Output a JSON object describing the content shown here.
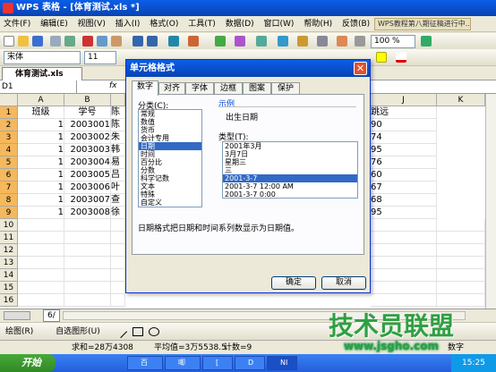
{
  "window": {
    "title": "WPS 表格 - [体育测试.xls *]"
  },
  "menu": [
    "文件(F)",
    "编辑(E)",
    "视图(V)",
    "插入(I)",
    "格式(O)",
    "工具(T)",
    "数据(D)",
    "窗口(W)",
    "帮助(H)",
    "反馈(B)"
  ],
  "banner": "WPS教程第八期征稿进行中...",
  "toolbar": {
    "zoom": "100 %"
  },
  "formatbar": {
    "font": "宋体",
    "size": "11"
  },
  "filetab": {
    "name": "体育测试.xls"
  },
  "formula": {
    "namebox": "D1",
    "fx": "fx"
  },
  "grid": {
    "columns": [
      "A",
      "B",
      "J",
      "K"
    ],
    "rows": [
      "1",
      "2",
      "3",
      "4",
      "5",
      "6",
      "7",
      "8",
      "9",
      "10",
      "11",
      "12",
      "13",
      "14",
      "15",
      "16"
    ],
    "headerA": "班级",
    "headerB": "学号",
    "headerC": "陈",
    "headerI": "跳远",
    "data": [
      {
        "a": "1",
        "b": "2003001",
        "c": "陈",
        "i": "90"
      },
      {
        "a": "1",
        "b": "2003002",
        "c": "朱",
        "i": "74"
      },
      {
        "a": "1",
        "b": "2003003",
        "c": "韩",
        "i": "95"
      },
      {
        "a": "1",
        "b": "2003004",
        "c": "易",
        "i": "76"
      },
      {
        "a": "1",
        "b": "2003005",
        "c": "吕",
        "i": "60"
      },
      {
        "a": "1",
        "b": "2003006",
        "c": "叶",
        "i": "67"
      },
      {
        "a": "1",
        "b": "2003007",
        "c": "查",
        "i": "68"
      },
      {
        "a": "1",
        "b": "2003008",
        "c": "徐",
        "i": "95"
      }
    ]
  },
  "sheetbar": {
    "tab": "6/"
  },
  "drawbar": {
    "label": "绘图(R)",
    "autoshape": "自选图形(U)"
  },
  "status": {
    "sum": "求和=28万4308",
    "avg": "平均值=3万5538.5",
    "count": "计数=9",
    "mode": "数字"
  },
  "taskbar": {
    "start": "开始",
    "items": [
      "百",
      "唧",
      "[",
      "D",
      "NI"
    ],
    "clock": "15:25"
  },
  "dialog": {
    "title": "单元格格式",
    "tabs": [
      "数字",
      "对齐",
      "字体",
      "边框",
      "图案",
      "保护"
    ],
    "category_label": "分类(C):",
    "categories": [
      "常规",
      "数值",
      "货币",
      "会计专用",
      "日期",
      "时间",
      "百分比",
      "分数",
      "科学记数",
      "文本",
      "特殊",
      "自定义"
    ],
    "selected_category": 4,
    "sample_label": "示例",
    "sample_value": "出生日期",
    "type_label": "类型(T):",
    "types": [
      "2001年3月",
      "3月7日",
      "星期三",
      "三",
      "2001-3-7",
      "2001-3-7 12:00 AM",
      "2001-3-7 0:00"
    ],
    "selected_type": 4,
    "description": "日期格式把日期和时间系列数显示为日期值。",
    "ok": "确定",
    "cancel": "取消"
  },
  "watermark": {
    "line1": "技术员联盟",
    "line2": "www.jsgho.com"
  }
}
